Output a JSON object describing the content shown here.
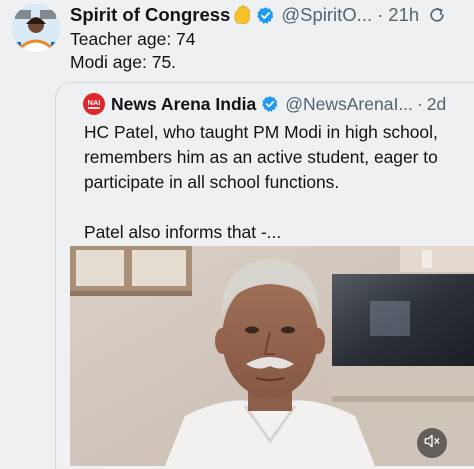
{
  "post": {
    "display_name": "Spirit of Congress",
    "handle": "@SpiritO...",
    "separator": "·",
    "time": "21h",
    "lines": [
      "Teacher age: 74",
      "Modi age: 75."
    ]
  },
  "quote": {
    "logo_text": "NAI",
    "display_name": "News Arena India",
    "handle": "@NewsArenaI...",
    "separator": "·",
    "time": "2d",
    "paragraph1": "HC Patel, who taught PM Modi in high school, remembers him as an active student, eager to participate in all school functions.",
    "paragraph2": "Patel also informs that -..."
  },
  "colors": {
    "accent_blue": "#1d9bf0",
    "brand_red": "#e0262b",
    "background": "#eef0f1"
  },
  "icons": {
    "verified": "verified-badge-icon",
    "hand": "raised-hand-emoji-icon",
    "refresh": "refresh-icon",
    "mute": "speaker-muted-icon"
  }
}
